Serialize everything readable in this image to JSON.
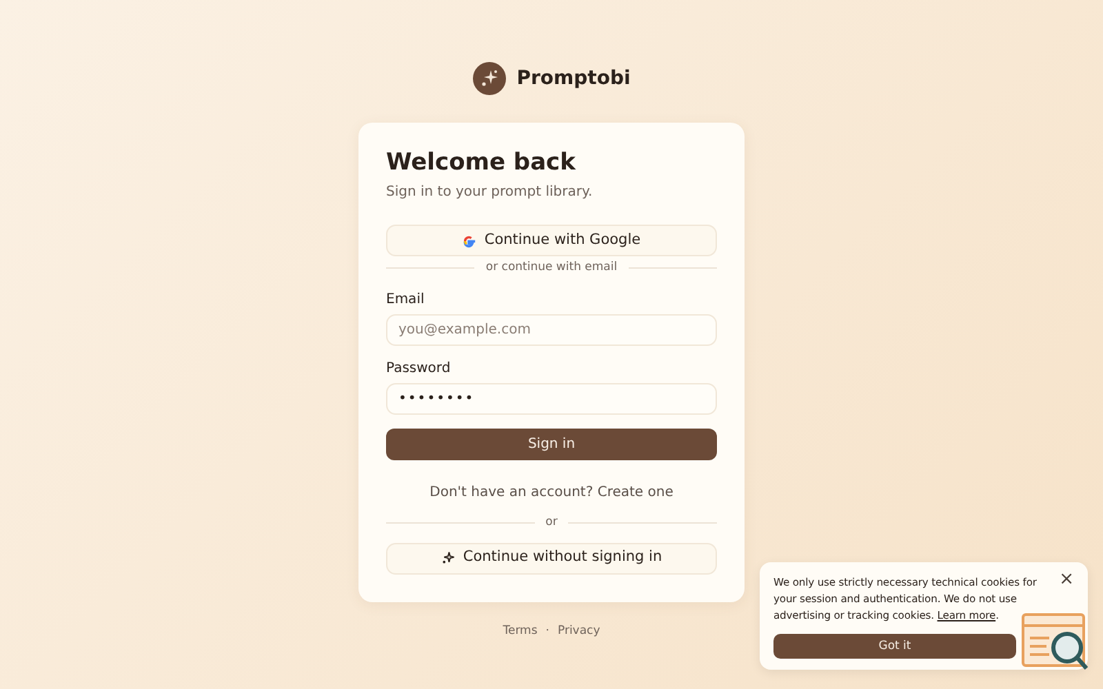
{
  "brand": {
    "name": "Promptobi"
  },
  "card": {
    "title": "Welcome back",
    "subtitle": "Sign in to your prompt library.",
    "google_button": "Continue with Google",
    "email_divider": "or continue with email",
    "fields": [
      {
        "label": "Email",
        "placeholder": "you@example.com"
      },
      {
        "label": "Password",
        "value": "••••••••",
        "kind": "password"
      }
    ],
    "submit": "Sign in",
    "signup_prompt": "Don't have an account?",
    "signup_link": "Create one",
    "or_divider": "or",
    "guest_button": "Continue without signing in"
  },
  "footer": {
    "links": [
      "Terms",
      "Privacy"
    ],
    "separator": "·"
  },
  "cookie_banner": {
    "text": "We only use strictly necessary technical cookies for your session and authentication. We do not use advertising or tracking cookies.",
    "link": "Learn more",
    "text_after": ".",
    "close": "×",
    "button": "Got it"
  }
}
